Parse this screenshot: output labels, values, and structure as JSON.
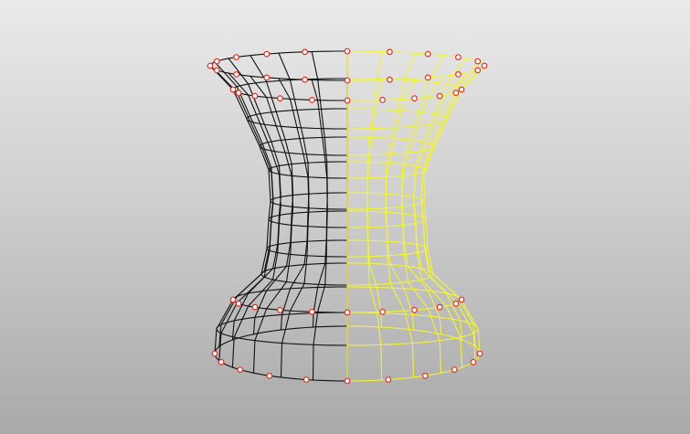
{
  "viewport": {
    "background_top": "#eaeaea",
    "background_bottom": "#a9a9a9"
  },
  "colors": {
    "wire_unselected": "#111111",
    "wire_selected": "#f2f23a",
    "control_point_fill": "#ffffff",
    "control_point_stroke": "#e03020"
  },
  "object": {
    "shape": "hyperboloid-surface",
    "selected_half": "right"
  }
}
